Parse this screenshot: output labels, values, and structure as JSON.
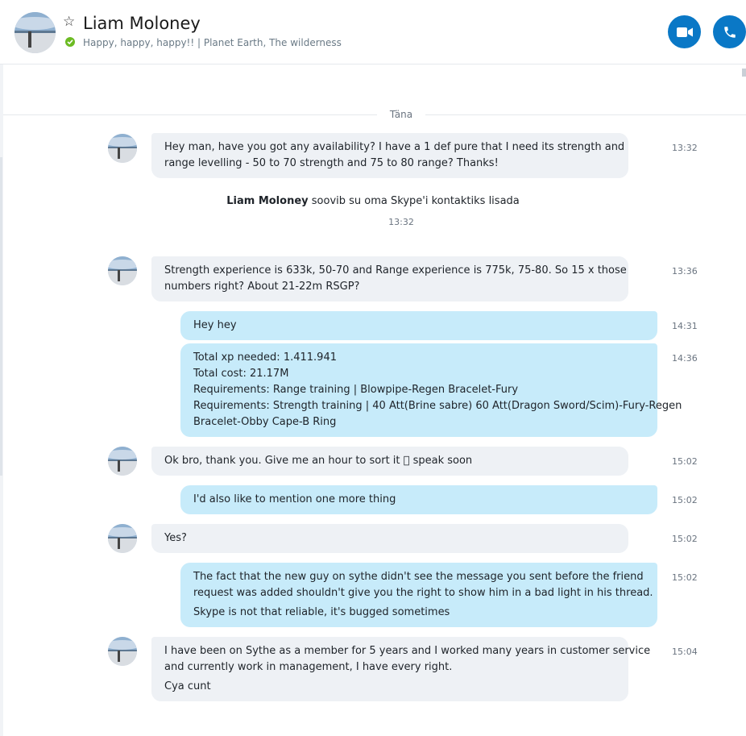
{
  "header": {
    "contact_name": "Liam Moloney",
    "mood": "Happy, happy, happy!! | Planet Earth, The wilderness",
    "status": "online",
    "status_color": "#6cbb23",
    "accent_color": "#0a78c6",
    "buttons": {
      "video_call": "video-camera-icon",
      "audio_call": "phone-icon"
    }
  },
  "conversation": {
    "day_label": "Täna",
    "system_message": {
      "name": "Liam Moloney",
      "text": "soovib su oma Skype'i kontaktiks lisada",
      "time": "13:32"
    },
    "messages": [
      {
        "direction": "in",
        "time": "13:32",
        "lines": [
          "Hey man, have you got any availability? I have a 1 def pure that I need its strength and",
          "range levelling - 50 to 70 strength and 75 to 80 range? Thanks!"
        ]
      },
      {
        "direction": "in",
        "time": "13:36",
        "lines": [
          "Strength experience is 633k, 50-70 and Range experience is 775k, 75-80. So 15 x those",
          "numbers right? About 21-22m RSGP?"
        ]
      },
      {
        "direction": "out",
        "time": "14:31",
        "lines": [
          "Hey hey"
        ]
      },
      {
        "direction": "out",
        "time": "14:36",
        "lines": [
          "Total xp needed: 1.411.941",
          "Total cost: 21.17M",
          "Requirements: Range training | Blowpipe-Regen Bracelet-Fury",
          "Requirements: Strength training | 40 Att(Brine sabre) 60 Att(Dragon Sword/Scim)-Fury-Regen",
          "Bracelet-Obby Cape-B Ring"
        ]
      },
      {
        "direction": "in",
        "time": "15:02",
        "lines": [
          "Ok bro, thank you. Give me an hour to sort it \u0000 speak soon"
        ]
      },
      {
        "direction": "out",
        "time": "15:02",
        "lines": [
          "I'd also like to mention one more thing"
        ]
      },
      {
        "direction": "in",
        "time": "15:02",
        "lines": [
          "Yes?"
        ]
      },
      {
        "direction": "out",
        "time": "15:02",
        "lines": [
          "The fact that the new guy on sythe didn't see the message you sent before the friend",
          "request was added shouldn't give you the right to show him in a bad light in his thread."
        ],
        "extra": "Skype is not that reliable, it's bugged sometimes"
      },
      {
        "direction": "in",
        "time": "15:04",
        "lines": [
          "I have been on Sythe as a member for 5 years and I worked many years in customer service",
          "and currently work in management, I have every right."
        ],
        "extra": "Cya cunt"
      }
    ]
  }
}
